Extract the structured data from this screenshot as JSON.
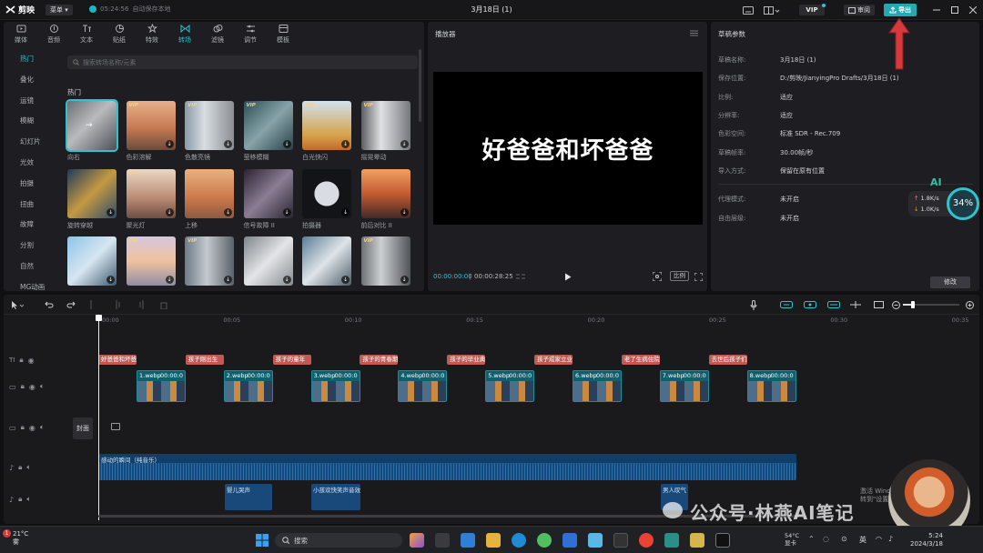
{
  "titlebar": {
    "app_name": "剪映",
    "menu_label": "菜单",
    "autosave_time": "05:24:56",
    "autosave_text": "自动保存本地",
    "document_title": "3月18日 (1)",
    "vip_label": "VIP",
    "review_label": "审阅",
    "export_label": "导出"
  },
  "media_tabs": [
    {
      "label": "媒体",
      "icon": "media-icon"
    },
    {
      "label": "音频",
      "icon": "audio-icon"
    },
    {
      "label": "文本",
      "icon": "text-icon"
    },
    {
      "label": "贴纸",
      "icon": "sticker-icon"
    },
    {
      "label": "特效",
      "icon": "effects-icon"
    },
    {
      "label": "转场",
      "icon": "transition-icon",
      "active": true
    },
    {
      "label": "滤镜",
      "icon": "filter-icon"
    },
    {
      "label": "调节",
      "icon": "adjust-icon"
    },
    {
      "label": "模板",
      "icon": "template-icon"
    }
  ],
  "side_categories": [
    "热门",
    "叠化",
    "运镜",
    "模糊",
    "幻灯片",
    "光效",
    "拍摄",
    "扭曲",
    "故障",
    "分割",
    "自然",
    "MG动画"
  ],
  "search": {
    "placeholder": "搜索转场名称/元素"
  },
  "section_title": "热门",
  "transitions": [
    {
      "label": "向右",
      "vip": false,
      "download": false,
      "selected": true
    },
    {
      "label": "色彩溶解",
      "vip": true,
      "download": true
    },
    {
      "label": "色散亮镜",
      "vip": true,
      "download": true
    },
    {
      "label": "萤移模糊",
      "vip": true,
      "download": true
    },
    {
      "label": "白光快闪",
      "vip": true,
      "download": true
    },
    {
      "label": "摇晃晕动",
      "vip": true,
      "download": true
    },
    {
      "label": "旋转穿越",
      "vip": false,
      "download": true
    },
    {
      "label": "聚光灯",
      "vip": true,
      "download": true
    },
    {
      "label": "上移",
      "vip": false,
      "download": true
    },
    {
      "label": "信号故障 II",
      "vip": false,
      "download": true
    },
    {
      "label": "拍摄器",
      "vip": false,
      "download": true
    },
    {
      "label": "前后对比 II",
      "vip": false,
      "download": true
    },
    {
      "label": "",
      "vip": false,
      "download": true
    },
    {
      "label": "",
      "vip": true,
      "download": true
    },
    {
      "label": "",
      "vip": true,
      "download": true
    },
    {
      "label": "",
      "vip": false,
      "download": true
    },
    {
      "label": "",
      "vip": false,
      "download": true
    },
    {
      "label": "",
      "vip": true,
      "download": true
    }
  ],
  "player": {
    "title": "播放器",
    "caption": "好爸爸和坏爸爸",
    "time_current": "00:00:00:00",
    "time_total": "00:00:28:25",
    "ratio_label": "比例"
  },
  "draft": {
    "title": "草稿参数",
    "rows": [
      {
        "label": "草稿名称:",
        "value": "3月18日 (1)"
      },
      {
        "label": "保存位置:",
        "value": "D:/剪映/JianyingPro Drafts/3月18日 (1)"
      },
      {
        "label": "比例:",
        "value": "适应"
      },
      {
        "label": "分辨率:",
        "value": "适应"
      },
      {
        "label": "色彩空间:",
        "value": "标准 SDR - Rec.709"
      },
      {
        "label": "草稿帧率:",
        "value": "30.00帧/秒"
      },
      {
        "label": "导入方式:",
        "value": "保留在原有位置"
      }
    ],
    "rows2": [
      {
        "label": "代理模式:",
        "value": "未开启"
      },
      {
        "label": "自由层级:",
        "value": "未开启"
      }
    ],
    "modify_label": "修改"
  },
  "net_widget": {
    "ai": "AI",
    "up": "1.8K/s",
    "down": "1.0K/s",
    "percent": "34%"
  },
  "ruler": {
    "ticks": [
      "00:00",
      "00:05",
      "00:10",
      "00:15",
      "00:20",
      "00:25",
      "00:30",
      "00:35"
    ]
  },
  "text_clips": [
    "好爸爸和坏爸",
    "孩子刚出生",
    "孩子的童年",
    "孩子的青春期",
    "孩子的毕业典",
    "孩子成家立业",
    "老了生病住院",
    "去世后孩子们"
  ],
  "video_clips": [
    {
      "name": "1.webp",
      "time": "00:00:0"
    },
    {
      "name": "2.webp",
      "time": "00:00:0"
    },
    {
      "name": "3.webp",
      "time": "00:00:0"
    },
    {
      "name": "4.webp",
      "time": "00:00:0"
    },
    {
      "name": "5.webp",
      "time": "00:00:0"
    },
    {
      "name": "6.webp",
      "time": "00:00:0"
    },
    {
      "name": "7.webp",
      "time": "00:00:0"
    },
    {
      "name": "8.webp",
      "time": "00:00:0"
    }
  ],
  "cover_label": "封面",
  "music_clip": "感动的瞬间（纯音乐）",
  "sfx_clips": [
    "婴儿哭声",
    "小孩欢快笑声音效",
    "男人叹气"
  ],
  "overlay": {
    "watermark": "公众号·林燕AI笔记",
    "activate_line1": "激活 Windows",
    "activate_line2": "转到\"设置\"以激活 Windows。"
  },
  "taskbar": {
    "temp": "21°C",
    "weather": "雾",
    "search_label": "搜索",
    "temp2": "54°C",
    "temp2_label": "显卡",
    "ime": "英",
    "time": "5:24",
    "date": "2024/3/18"
  },
  "colors": {
    "accent": "#2ec3cd",
    "text_clip": "#c05a53",
    "video_clip": "#0f5f6c",
    "audio_clip": "#0f3e6a",
    "export": "#24a9b3"
  }
}
